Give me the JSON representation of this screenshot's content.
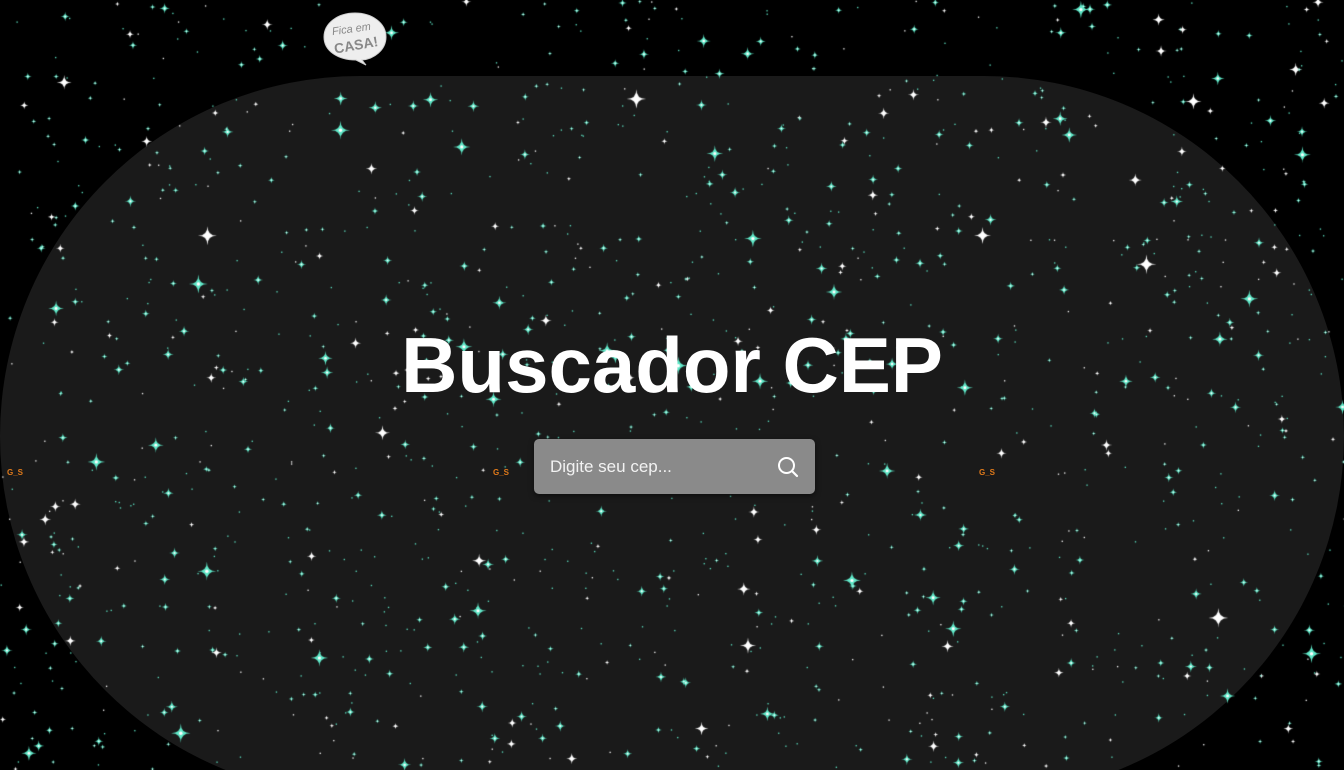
{
  "page": {
    "title": "Buscador CEP",
    "badge_text": "Fica em CASA!"
  },
  "search": {
    "placeholder": "Digite seu cep...",
    "value": "",
    "icon": "search-icon"
  },
  "watermarks": [
    "G_S",
    "G_S",
    "G_S"
  ],
  "colors": {
    "background": "#000000",
    "panel": "#1a1a1a",
    "search_box": "#8a8a8a",
    "star_primary": "#5fe8c8",
    "star_secondary": "#ffffff",
    "watermark": "#e07a1a"
  }
}
